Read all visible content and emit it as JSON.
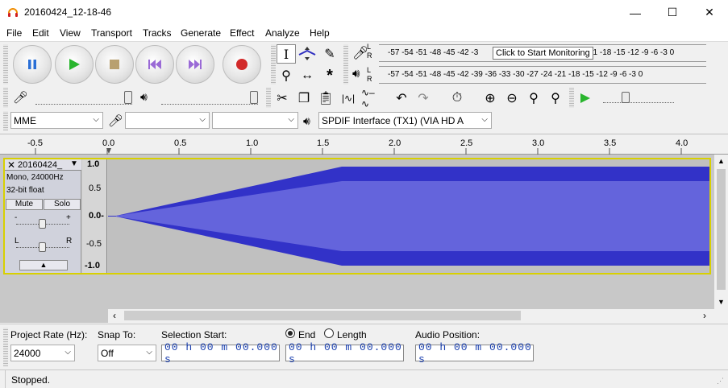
{
  "window": {
    "title": "20160424_12-18-46",
    "minimize": "—",
    "maximize": "☐",
    "close": "✕"
  },
  "menu": [
    "File",
    "Edit",
    "View",
    "Transport",
    "Tracks",
    "Generate",
    "Effect",
    "Analyze",
    "Help"
  ],
  "meters": {
    "record_scale": "-57 -54 -51 -48 -45 -42 -3",
    "record_scale_tail": "21 -18 -15 -12  -9  -6  -3  0",
    "tooltip": "Click to Start Monitoring",
    "play_scale": "-57 -54 -51 -48 -45 -42 -39 -36 -33 -30 -27 -24 -21 -18 -15 -12  -9  -6  -3  0",
    "lr": "L R"
  },
  "devices": {
    "host": "MME",
    "recording": "",
    "channels": "",
    "playback": "SPDIF Interface (TX1) (VIA HD A"
  },
  "ruler": {
    "ticks": [
      "-0.5",
      "0.0",
      "0.5",
      "1.0",
      "1.5",
      "2.0",
      "2.5",
      "3.0",
      "3.5",
      "4.0"
    ]
  },
  "track": {
    "name": "20160424_",
    "format": "Mono, 24000Hz",
    "sample": "32-bit float",
    "mute": "Mute",
    "solo": "Solo",
    "gain_minus": "-",
    "gain_plus": "+",
    "pan_l": "L",
    "pan_r": "R",
    "scale": [
      "1.0",
      "0.5",
      "0.0-",
      "-0.5",
      "-1.0"
    ]
  },
  "selection": {
    "project_rate_label": "Project Rate (Hz):",
    "project_rate": "24000",
    "snap_label": "Snap To:",
    "snap": "Off",
    "sel_start_label": "Selection Start:",
    "end_label": "End",
    "length_label": "Length",
    "audio_pos_label": "Audio Position:",
    "time1": "00 h 00 m 00.000 s",
    "time2": "00 h 00 m 00.000 s",
    "time3": "00 h 00 m 00.000 s"
  },
  "status": "Stopped.",
  "colors": {
    "waveform": "#3232c8",
    "rms": "#6464dc",
    "selection_border": "#d8d000"
  }
}
